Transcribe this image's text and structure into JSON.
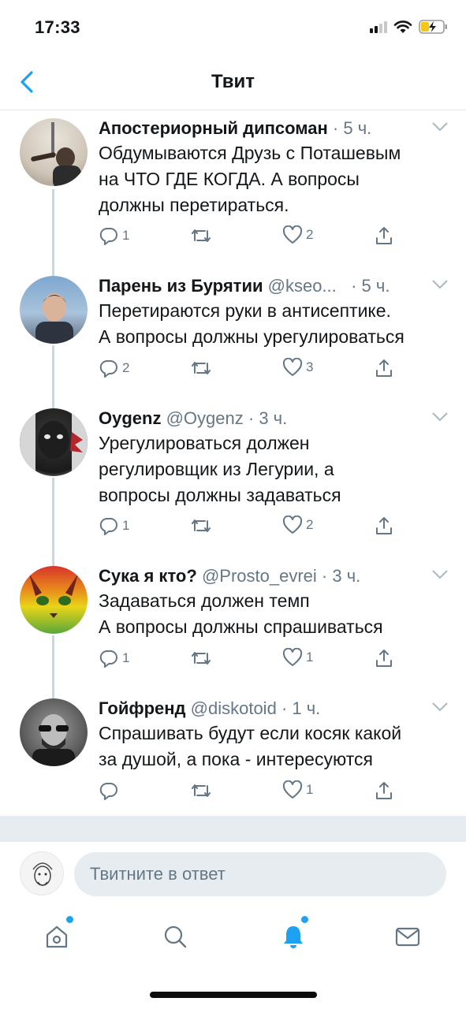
{
  "status_bar": {
    "time": "17:33"
  },
  "header": {
    "title": "Твит"
  },
  "tweets": [
    {
      "name": "Апостериорный дипсоман",
      "handle": "",
      "time": "· 5 ч.",
      "text_lines": [
        "Обдумываются Друзь с Поташевым",
        "на ЧТО ГДЕ КОГДА. А вопросы",
        "должны перетираться."
      ],
      "replies": "1",
      "retweets": "",
      "likes": "2"
    },
    {
      "name": "Парень из Бурятии",
      "handle": "@kseo...",
      "time": "· 5 ч.",
      "text_lines": [
        "Перетираются руки в антисептике.",
        "А вопросы должны урегулироваться"
      ],
      "replies": "2",
      "retweets": "",
      "likes": "3"
    },
    {
      "name": "Oygenz",
      "handle": "@Oygenz",
      "time": "· 3 ч.",
      "text_lines": [
        "Урегулироваться должен",
        "регулировщик из Легурии, а",
        "вопросы должны задаваться"
      ],
      "replies": "1",
      "retweets": "",
      "likes": "2"
    },
    {
      "name": "Сука я кто?",
      "handle": "@Prosto_evrei",
      "time": "· 3 ч.",
      "text_lines": [
        "Задаваться должен темп",
        "А вопросы должны спрашиваться"
      ],
      "replies": "1",
      "retweets": "",
      "likes": "1"
    },
    {
      "name": "Гойфренд",
      "handle": "@diskotoid",
      "time": "· 1 ч.",
      "text_lines": [
        "Спрашивать будут если косяк какой",
        "за душой, а пока - интересуются"
      ],
      "replies": "",
      "retweets": "",
      "likes": "1"
    }
  ],
  "reply_bar": {
    "placeholder": "Твитните в ответ"
  },
  "tab_bar": {
    "items": [
      "home-icon",
      "search-icon",
      "notifications-icon",
      "messages-icon"
    ]
  },
  "colors": {
    "accent": "#1da1f2",
    "secondary_text": "#657786",
    "divider": "#e1e8ed"
  }
}
